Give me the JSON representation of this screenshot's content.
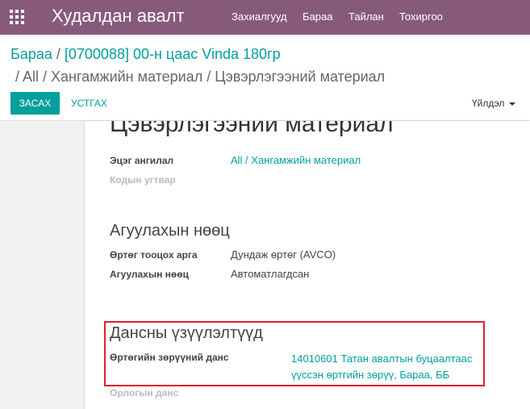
{
  "topbar": {
    "app_title": "Худалдан авалт",
    "menu": [
      "Захиалгууд",
      "Бараа",
      "Тайлан",
      "Тохиргоо"
    ]
  },
  "breadcrumb": {
    "root": "Бараа",
    "current": "[0700088] 00-н цаас Vinda 180гр",
    "path": "All / Хангамжийн материал / Цэвэрлэгээний материал"
  },
  "buttons": {
    "edit": "ЗАСАХ",
    "delete": "УСТГАХ",
    "action": "Үйлдэл"
  },
  "form": {
    "title": "Цэвэрлэгээний материал",
    "parent_category_label": "Эцэг ангилал",
    "parent_category_value": "All / Хангамжийн материал",
    "code_prefix_label": "Кодын угтвар",
    "inventory_section": "Агуулахын нөөц",
    "costing_method_label": "Өртөг тооцох арга",
    "costing_method_value": "Дундаж өртөг (AVCO)",
    "inventory_valuation_label": "Агуулахын нөөц",
    "inventory_valuation_value": "Автоматлагдсан",
    "accounts_section": "Дансны үзүүлэлтүүд",
    "price_diff_label": "Өртөгийн зөрүүний данс",
    "price_diff_value": "14010601 Татан авалтын буцаалтаас үүссэн өртгийн зөрүү, Бараа, ББ",
    "expense_account_label": "Орлогын данс"
  },
  "colors": {
    "brand": "#875a7b",
    "accent": "#00a09d",
    "highlight": "#d9252b"
  }
}
